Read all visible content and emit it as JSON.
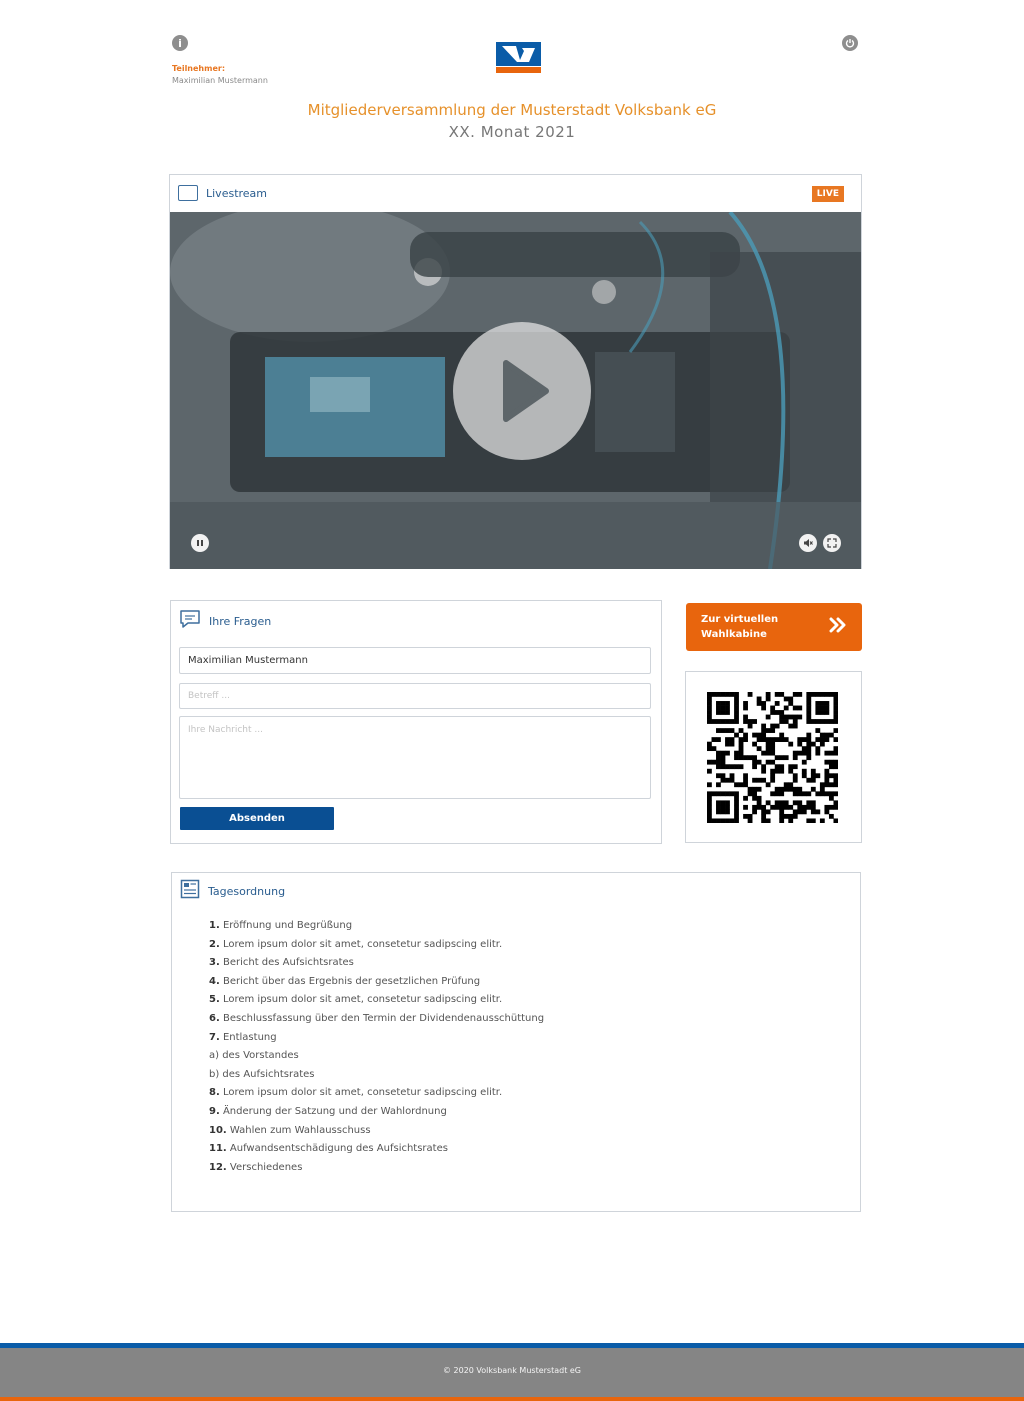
{
  "header": {
    "participant_label": "Teilnehmer:",
    "participant_name": "Maximilian Mustermann",
    "title": "Mitgliederversammlung der Musterstadt Volksbank eG",
    "date": "XX. Monat 2021",
    "info_icon": "info-icon",
    "power_icon": "power-icon"
  },
  "livestream": {
    "title": "Livestream",
    "badge": "LIVE"
  },
  "questions": {
    "title": "Ihre Fragen",
    "name_value": "Maximilian Mustermann",
    "subject_placeholder": "Betreff ...",
    "message_placeholder": "Ihre Nachricht ...",
    "submit_label": "Absenden"
  },
  "vote": {
    "line1": "Zur virtuellen",
    "line2": "Wahlkabine"
  },
  "agenda": {
    "title": "Tagesordnung",
    "items": [
      {
        "num": "1.",
        "text": "Eröffnung und Begrüßung"
      },
      {
        "num": "2.",
        "text": "Lorem ipsum dolor sit amet, consetetur sadipscing elitr."
      },
      {
        "num": "3.",
        "text": "Bericht des Aufsichtsrates"
      },
      {
        "num": "4.",
        "text": "Bericht über das Ergebnis der gesetzlichen Prüfung"
      },
      {
        "num": "5.",
        "text": "Lorem ipsum dolor sit amet, consetetur sadipscing elitr."
      },
      {
        "num": "6.",
        "text": "Beschlussfassung über den Termin der Dividendenausschüttung"
      },
      {
        "num": "7.",
        "text": "Entlastung"
      },
      {
        "num": "",
        "text": "a) des Vorstandes"
      },
      {
        "num": "",
        "text": "b) des Aufsichtsrates"
      },
      {
        "num": "8.",
        "text": "Lorem ipsum dolor sit amet, consetetur sadipscing elitr."
      },
      {
        "num": "9.",
        "text": "Änderung der Satzung und der Wahlordnung"
      },
      {
        "num": "10.",
        "text": "Wahlen zum Wahlausschuss"
      },
      {
        "num": "11.",
        "text": "Aufwandsentschädigung des Aufsichtsrates"
      },
      {
        "num": "12.",
        "text": "Verschiedenes"
      }
    ]
  },
  "footer": {
    "copyright": "© 2020 Volksbank Musterstadt eG"
  },
  "colors": {
    "orange": "#e87722",
    "blue": "#0a4f93",
    "footer_gray": "#858585"
  }
}
